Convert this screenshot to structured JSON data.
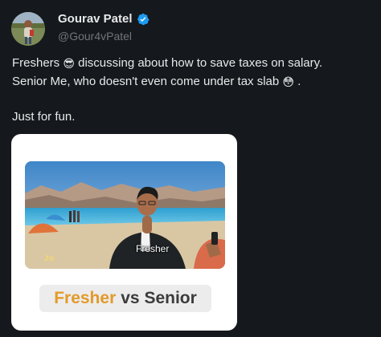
{
  "author": {
    "display_name": "Gourav Patel",
    "handle": "@Gour4vPatel",
    "verified_icon": "verified-badge-icon",
    "colors": {
      "verified": "#1d9bf0",
      "handle": "#71767b"
    }
  },
  "tweet": {
    "line1_a": "Freshers ",
    "line1_emoji": "😎",
    "line1_b": " discussing about how to save taxes on salary.",
    "line2_a": "Senior Me, who doesn't even come under tax slab ",
    "line2_emoji": "😳",
    "line2_b": " .",
    "line3": "Just for fun."
  },
  "media": {
    "overlay_caption": "Fresher",
    "watermark": "J⊙",
    "title_word1": "Fresher",
    "title_word2": "vs Senior",
    "colors": {
      "title_accent": "#e39a2a",
      "card_bg": "#ffffff",
      "frame_border": "#f08a6a"
    }
  },
  "theme": {
    "background": "#15181c",
    "text": "#e7e9ea"
  }
}
